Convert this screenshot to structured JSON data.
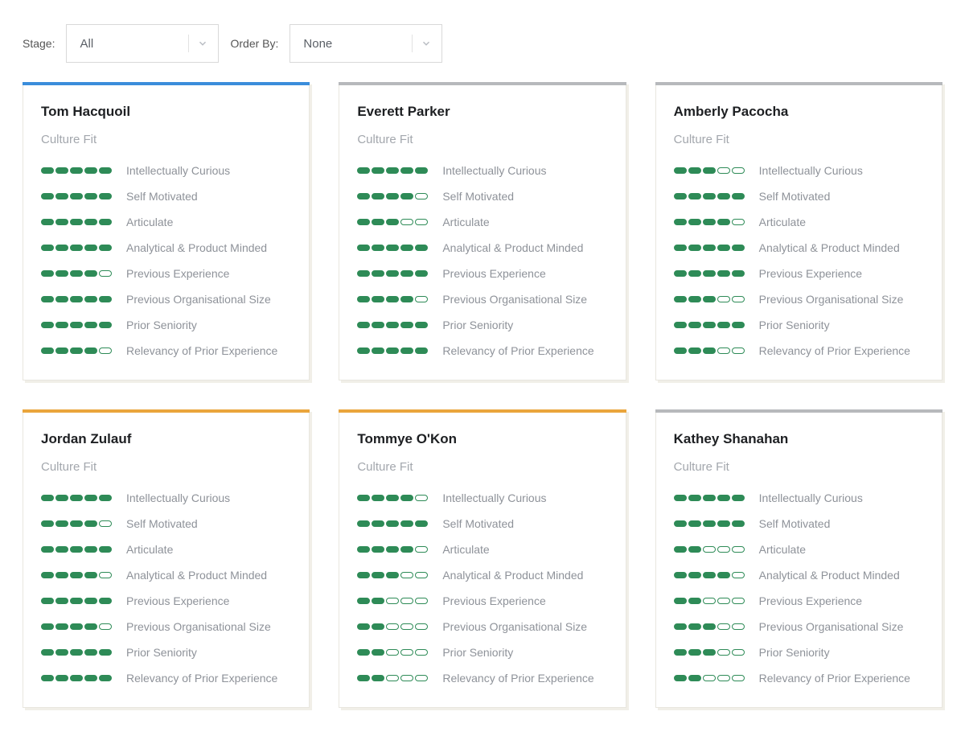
{
  "filters": {
    "stage_label": "Stage:",
    "stage_value": "All",
    "order_label": "Order By:",
    "order_value": "None"
  },
  "section_title": "Culture Fit",
  "trait_labels": [
    "Intellectually Curious",
    "Self Motivated",
    "Articulate",
    "Analytical & Product Minded",
    "Previous Experience",
    "Previous Organisational Size",
    "Prior Seniority",
    "Relevancy of Prior Experience"
  ],
  "max_score": 5,
  "accent_colors": {
    "blue": "#3a8ddb",
    "gray": "#b7b9bc",
    "orange": "#eaa53c"
  },
  "candidates": [
    {
      "name": "Tom Hacquoil",
      "accent": "blue",
      "scores": [
        5,
        5,
        5,
        5,
        4,
        5,
        5,
        4
      ]
    },
    {
      "name": "Everett Parker",
      "accent": "gray",
      "scores": [
        5,
        4,
        3,
        5,
        5,
        4,
        5,
        5
      ]
    },
    {
      "name": "Amberly Pacocha",
      "accent": "gray",
      "scores": [
        3,
        5,
        4,
        5,
        5,
        3,
        5,
        3
      ]
    },
    {
      "name": "Jordan Zulauf",
      "accent": "orange",
      "scores": [
        5,
        4,
        5,
        4,
        5,
        4,
        5,
        5
      ]
    },
    {
      "name": "Tommye O'Kon",
      "accent": "orange",
      "scores": [
        4,
        5,
        4,
        3,
        2,
        2,
        2,
        2
      ]
    },
    {
      "name": "Kathey Shanahan",
      "accent": "gray",
      "scores": [
        5,
        5,
        2,
        4,
        2,
        3,
        3,
        2
      ]
    }
  ]
}
